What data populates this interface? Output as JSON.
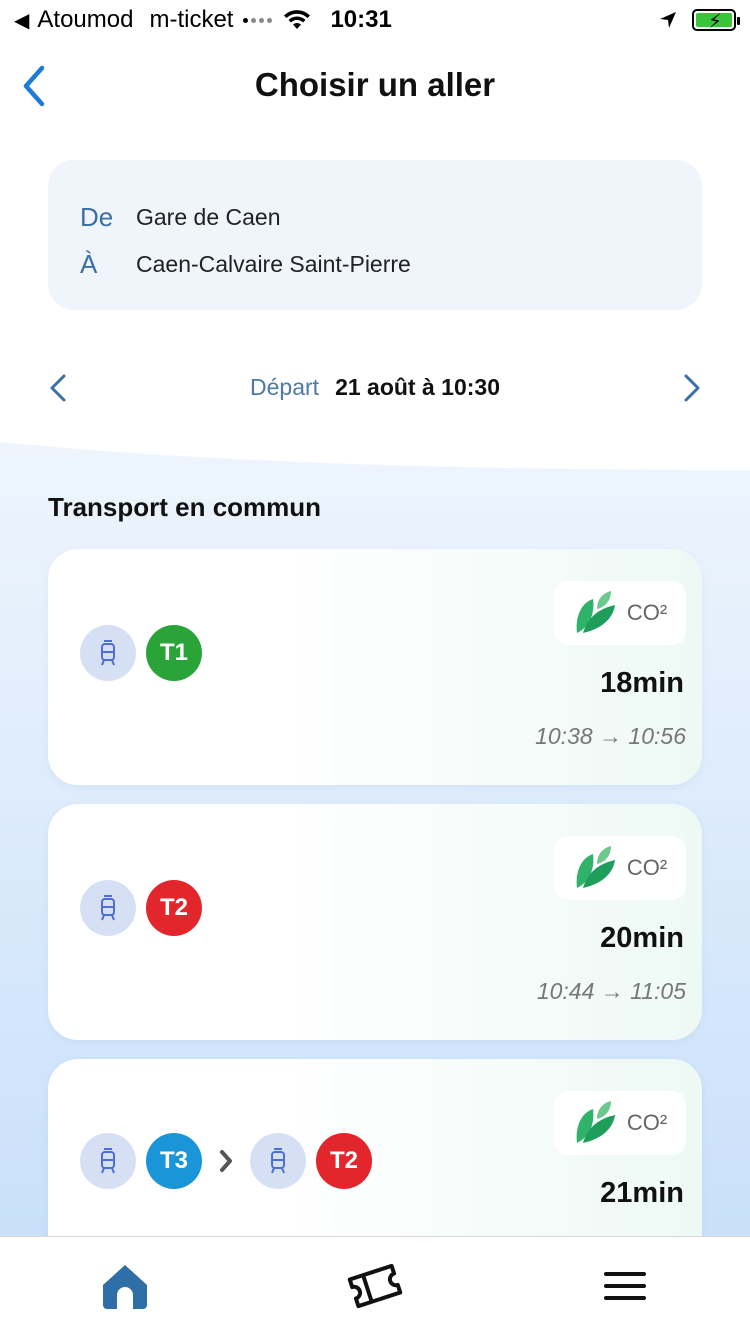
{
  "status_bar": {
    "back_app": "Atoumod",
    "carrier": "m-ticket",
    "time": "10:31"
  },
  "header": {
    "title": "Choisir un aller"
  },
  "route": {
    "from_label": "De",
    "from_value": "Gare de Caen",
    "to_label": "À",
    "to_value": "Caen-Calvaire Saint-Pierre"
  },
  "date": {
    "label": "Départ",
    "value": "21 août à 10:30"
  },
  "section": {
    "title": "Transport en commun"
  },
  "journeys": [
    {
      "lines": [
        {
          "name": "T1",
          "color": "#2aa338"
        }
      ],
      "co2_label": "CO²",
      "duration": "18min",
      "times": "10:38 → 10:56"
    },
    {
      "lines": [
        {
          "name": "T2",
          "color": "#e3262c"
        }
      ],
      "co2_label": "CO²",
      "duration": "20min",
      "times": "10:44 → 11:05"
    },
    {
      "lines": [
        {
          "name": "T3",
          "color": "#1a96d8"
        },
        {
          "name": "T2",
          "color": "#e3262c"
        }
      ],
      "co2_label": "CO²",
      "duration": "21min",
      "times": ""
    }
  ],
  "nav": {
    "items": [
      "home-icon",
      "ticket-icon",
      "menu-icon"
    ],
    "active_color": "#2f6fa8"
  },
  "colors": {
    "accent": "#1d7ad8",
    "label_blue": "#3b6fa6",
    "background_blue": "#d7e8fb"
  }
}
